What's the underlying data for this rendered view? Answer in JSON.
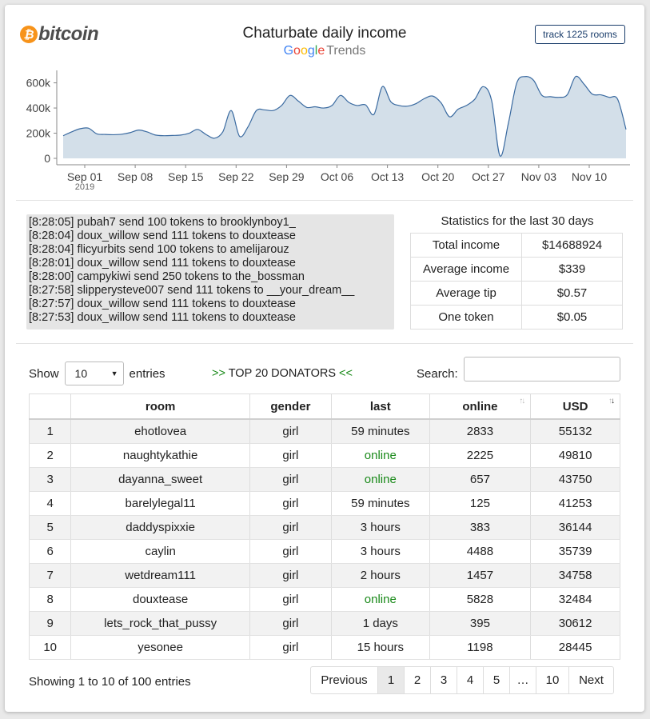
{
  "header": {
    "logo_text": "bitcoin",
    "logo_symbol": "₿",
    "title": "Chaturbate daily income",
    "google_letters": [
      {
        "ch": "G",
        "color": "#4285F4"
      },
      {
        "ch": "o",
        "color": "#EA4335"
      },
      {
        "ch": "o",
        "color": "#FBBC05"
      },
      {
        "ch": "g",
        "color": "#4285F4"
      },
      {
        "ch": "l",
        "color": "#34A853"
      },
      {
        "ch": "e",
        "color": "#EA4335"
      }
    ],
    "trends_label": "Trends",
    "track_button": "track 1225 rooms"
  },
  "chart_data": {
    "type": "area",
    "color": "#d3dfe9",
    "line_color": "#3a6aa0",
    "ylim": [
      0,
      680000
    ],
    "y_ticks": [
      0,
      200000,
      400000,
      600000
    ],
    "y_tick_labels": [
      "0",
      "200k",
      "400k",
      "600k"
    ],
    "x_tick_labels": [
      "Sep 01",
      "Sep 08",
      "Sep 15",
      "Sep 22",
      "Sep 29",
      "Oct 06",
      "Oct 13",
      "Oct 20",
      "Oct 27",
      "Nov 03",
      "Nov 10"
    ],
    "x_year_label": "2019",
    "x_start": "Aug 29",
    "x_end": "Nov 15",
    "values": [
      180000,
      210000,
      235000,
      240000,
      195000,
      190000,
      188000,
      192000,
      205000,
      225000,
      210000,
      185000,
      180000,
      182000,
      185000,
      200000,
      230000,
      190000,
      160000,
      210000,
      380000,
      175000,
      250000,
      380000,
      385000,
      380000,
      420000,
      500000,
      455000,
      405000,
      410000,
      400000,
      420000,
      500000,
      445000,
      420000,
      425000,
      350000,
      570000,
      450000,
      420000,
      415000,
      435000,
      475000,
      495000,
      440000,
      330000,
      390000,
      420000,
      470000,
      570000,
      460000,
      20000,
      280000,
      600000,
      650000,
      620000,
      500000,
      490000,
      485000,
      505000,
      650000,
      590000,
      510000,
      505000,
      485000,
      470000,
      230000
    ]
  },
  "log": [
    "[8:28:05] pubah7 send 100 tokens to brooklynboy1_",
    "[8:28:04] doux_willow send 111 tokens to douxtease",
    "[8:28:04] flicyurbits send 100 tokens to amelijarouz",
    "[8:28:01] doux_willow send 111 tokens to douxtease",
    "[8:28:00] campykiwi send 250 tokens to the_bossman",
    "[8:27:58] slipperysteve007 send 111 tokens to __your_dream__",
    "[8:27:57] doux_willow send 111 tokens to douxtease",
    "[8:27:53] doux_willow send 111 tokens to douxtease"
  ],
  "stats": {
    "title": "Statistics for the last 30 days",
    "rows": [
      {
        "label": "Total income",
        "value": "$14688924"
      },
      {
        "label": "Average income",
        "value": "$339"
      },
      {
        "label": "Average tip",
        "value": "$0.57"
      },
      {
        "label": "One token",
        "value": "$0.05"
      }
    ]
  },
  "controls": {
    "show_label": "Show",
    "entries_value": "10",
    "entries_label": "entries",
    "top_left": ">>",
    "top_text": " TOP 20 DONATORS ",
    "top_right": "<<",
    "search_label": "Search:",
    "search_value": ""
  },
  "table": {
    "columns": [
      "",
      "room",
      "gender",
      "last",
      "online",
      "USD"
    ],
    "rows": [
      {
        "n": "1",
        "room": "ehotlovea",
        "gender": "girl",
        "last": "59 minutes",
        "online": "2833",
        "usd": "55132"
      },
      {
        "n": "2",
        "room": "naughtykathie",
        "gender": "girl",
        "last": "online",
        "online": "2225",
        "usd": "49810"
      },
      {
        "n": "3",
        "room": "dayanna_sweet",
        "gender": "girl",
        "last": "online",
        "online": "657",
        "usd": "43750"
      },
      {
        "n": "4",
        "room": "barelylegal11",
        "gender": "girl",
        "last": "59 minutes",
        "online": "125",
        "usd": "41253"
      },
      {
        "n": "5",
        "room": "daddyspixxie",
        "gender": "girl",
        "last": "3 hours",
        "online": "383",
        "usd": "36144"
      },
      {
        "n": "6",
        "room": "caylin",
        "gender": "girl",
        "last": "3 hours",
        "online": "4488",
        "usd": "35739"
      },
      {
        "n": "7",
        "room": "wetdream111",
        "gender": "girl",
        "last": "2 hours",
        "online": "1457",
        "usd": "34758"
      },
      {
        "n": "8",
        "room": "douxtease",
        "gender": "girl",
        "last": "online",
        "online": "5828",
        "usd": "32484"
      },
      {
        "n": "9",
        "room": "lets_rock_that_pussy",
        "gender": "girl",
        "last": "1 days",
        "online": "395",
        "usd": "30612"
      },
      {
        "n": "10",
        "room": "yesonee",
        "gender": "girl",
        "last": "15 hours",
        "online": "1198",
        "usd": "28445"
      }
    ]
  },
  "footer": {
    "info": "Showing 1 to 10 of 100 entries",
    "pages": [
      "Previous",
      "1",
      "2",
      "3",
      "4",
      "5",
      "…",
      "10",
      "Next"
    ],
    "active_page": "1"
  }
}
